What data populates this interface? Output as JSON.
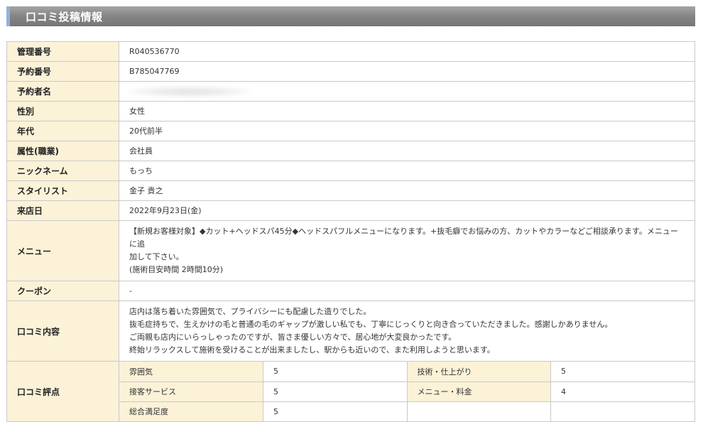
{
  "header": {
    "title": "口コミ投稿情報"
  },
  "rows": {
    "management_no": {
      "label": "管理番号",
      "value": "R040536770"
    },
    "reservation_no": {
      "label": "予約番号",
      "value": "B785047769"
    },
    "reserver_name": {
      "label": "予約者名",
      "value": ""
    },
    "gender": {
      "label": "性別",
      "value": "女性"
    },
    "age": {
      "label": "年代",
      "value": "20代前半"
    },
    "occupation": {
      "label": "属性(職業)",
      "value": "会社員"
    },
    "nickname": {
      "label": "ニックネーム",
      "value": "もっち"
    },
    "stylist": {
      "label": "スタイリスト",
      "value": "金子 貴之"
    },
    "visit_date": {
      "label": "来店日",
      "value": "2022年9月23日(金)"
    },
    "menu": {
      "label": "メニュー",
      "lines": [
        "【新規お客様対象】◆カット+ヘッドスパ45分◆ヘッドスパフルメニューになります。+抜毛癖でお悩みの方、カットやカラーなどご相談承ります。メニューに追",
        "加して下さい。",
        "(施術目安時間 2時間10分)"
      ]
    },
    "coupon": {
      "label": "クーポン",
      "value": "-"
    },
    "review": {
      "label": "口コミ内容",
      "lines": [
        "店内は落ち着いた雰囲気で、プライバシーにも配慮した造りでした。",
        "抜毛症持ちで、生えかけの毛と普通の毛のギャップが激しい私でも、丁寧にじっくりと向き合っていただきました。感謝しかありません。",
        "ご両親も店内にいらっしゃったのですが、皆さま優しい方々で、居心地が大変良かったです。",
        "終始リラックスして施術を受けることが出来ましたし、駅からも近いので、また利用しようと思います。"
      ]
    },
    "rating": {
      "label": "口コミ評点",
      "items": [
        {
          "label": "雰囲気",
          "value": "5"
        },
        {
          "label": "技術・仕上がり",
          "value": "5"
        },
        {
          "label": "接客サービス",
          "value": "5"
        },
        {
          "label": "メニュー・料金",
          "value": "4"
        },
        {
          "label": "総合満足度",
          "value": "5"
        }
      ]
    }
  }
}
